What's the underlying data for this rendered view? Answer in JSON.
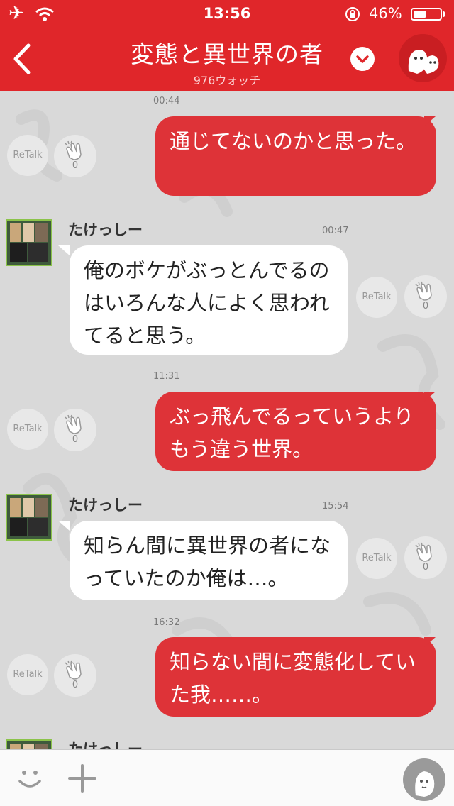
{
  "status": {
    "time": "13:56",
    "battery": "46%"
  },
  "header": {
    "title": "変態と異世界の者",
    "subtitle": "976ウォッチ"
  },
  "retalk_label": "ReTalk",
  "messages": [
    {
      "time": "00:44",
      "text": "通じてないのかと思った。",
      "clap": "0"
    },
    {
      "sender": "たけっしー",
      "time": "00:47",
      "text": "俺のボケがぶっとんでるのはいろんな人によく思われてると思う。",
      "clap": "0"
    },
    {
      "time": "11:31",
      "text": "ぶっ飛んでるっていうよりもう違う世界。",
      "clap": "0"
    },
    {
      "sender": "たけっしー",
      "time": "15:54",
      "text": "知らん間に異世界の者になっていたのか俺は…。",
      "clap": "0"
    },
    {
      "time": "16:32",
      "text": "知らない間に変態化していた我……。",
      "clap": "0"
    },
    {
      "sender": "たけっしー"
    }
  ],
  "colors": {
    "header": "#e0262a",
    "outgoing_bubble": "#de3338",
    "incoming_bubble": "#ffffff",
    "chat_bg": "#d9d9d9"
  }
}
